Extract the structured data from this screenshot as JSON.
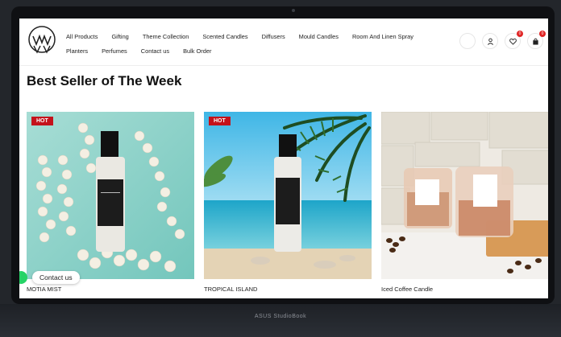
{
  "nav": {
    "row1": [
      "All Products",
      "Gifting",
      "Theme Collection",
      "Scented Candles",
      "Diffusers",
      "Mould Candles",
      "Room And Linen Spray"
    ],
    "row2": [
      "Planters",
      "Perfumes",
      "Contact us",
      "Bulk Order"
    ]
  },
  "header_icons": {
    "wishlist_badge": "0",
    "cart_badge": "0"
  },
  "section_title": "Best Seller of The Week",
  "products": [
    {
      "name": "MOTIA MIST",
      "badge": "HOT"
    },
    {
      "name": "TROPICAL ISLAND",
      "badge": "HOT"
    },
    {
      "name": "Iced Coffee Candle"
    }
  ],
  "contact_label": "Contact us",
  "laptop_brand": "ASUS StudioBook"
}
